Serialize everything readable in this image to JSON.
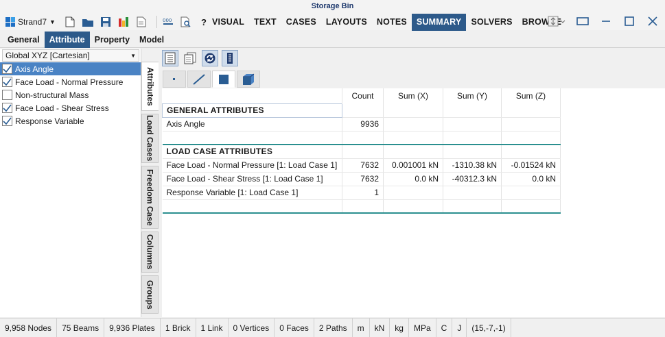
{
  "window": {
    "title": "Storage Bin"
  },
  "app": {
    "name": "Strand7"
  },
  "menu": [
    "VISUAL",
    "TEXT",
    "CASES",
    "LAYOUTS",
    "NOTES",
    "SUMMARY",
    "SOLVERS",
    "BROWSE"
  ],
  "menu_active": "SUMMARY",
  "quick_access": {
    "help": "?"
  },
  "subtabs": [
    "General",
    "Attribute",
    "Property",
    "Model"
  ],
  "subtab_active": "Attribute",
  "coordinate_system": "Global XYZ [Cartesian]",
  "attribute_list": [
    {
      "label": "Axis Angle",
      "checked": true,
      "selected": true
    },
    {
      "label": "Face Load - Normal Pressure",
      "checked": true,
      "selected": false
    },
    {
      "label": "Non-structural Mass",
      "checked": false,
      "selected": false
    },
    {
      "label": "Face Load - Shear Stress",
      "checked": true,
      "selected": false
    },
    {
      "label": "Response Variable",
      "checked": true,
      "selected": false
    }
  ],
  "side_tabs": [
    "Attributes",
    "Load Cases",
    "Freedom Case",
    "Columns",
    "Groups"
  ],
  "side_tab_active": "Attributes",
  "grid": {
    "columns": [
      "",
      "Count",
      "Sum (X)",
      "Sum (Y)",
      "Sum (Z)"
    ],
    "general_title": "GENERAL ATTRIBUTES",
    "general_rows": [
      {
        "name": "Axis Angle",
        "count": "9936",
        "sx": "",
        "sy": "",
        "sz": ""
      }
    ],
    "loadcase_title": "LOAD CASE ATTRIBUTES",
    "loadcase_rows": [
      {
        "name": "Face Load - Normal Pressure [1: Load Case 1]",
        "count": "7632",
        "sx": "0.001001 kN",
        "sy": "-1310.38 kN",
        "sz": "-0.01524 kN"
      },
      {
        "name": "Face Load - Shear Stress [1: Load Case 1]",
        "count": "7632",
        "sx": "0.0 kN",
        "sy": "-40312.3 kN",
        "sz": "0.0 kN"
      },
      {
        "name": "Response Variable [1: Load Case 1]",
        "count": "1",
        "sx": "",
        "sy": "",
        "sz": ""
      }
    ]
  },
  "status": [
    "9,958 Nodes",
    "75 Beams",
    "9,936 Plates",
    "1 Brick",
    "1 Link",
    "0 Vertices",
    "0 Faces",
    "2 Paths",
    "m",
    "kN",
    "kg",
    "MPa",
    "C",
    "J",
    "(15,-7,-1)"
  ],
  "colors": {
    "accent": "#2d5a8a",
    "selection": "#4a83c4",
    "teal_rule": "#2a8f8f"
  }
}
